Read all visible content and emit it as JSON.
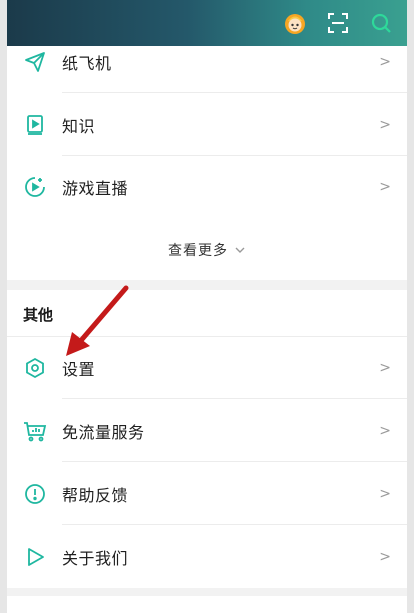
{
  "colors": {
    "accent": "#1fb7a0",
    "arrow": "#c41a1a",
    "header_start": "#1b3a4a",
    "header_end": "#3aa090"
  },
  "header": {
    "icons": [
      "avatar-icon",
      "scan-icon",
      "search-icon"
    ]
  },
  "top_menu": {
    "items": [
      {
        "label": "纸飞机",
        "icon": "paper-plane-icon"
      },
      {
        "label": "知识",
        "icon": "book-play-icon"
      },
      {
        "label": "游戏直播",
        "icon": "game-live-icon"
      }
    ],
    "more_label": "查看更多"
  },
  "other_section": {
    "title": "其他",
    "items": [
      {
        "label": "设置",
        "icon": "settings-hex-icon"
      },
      {
        "label": "免流量服务",
        "icon": "cart-chart-icon"
      },
      {
        "label": "帮助反馈",
        "icon": "help-circle-icon"
      },
      {
        "label": "关于我们",
        "icon": "play-outline-icon"
      }
    ]
  }
}
